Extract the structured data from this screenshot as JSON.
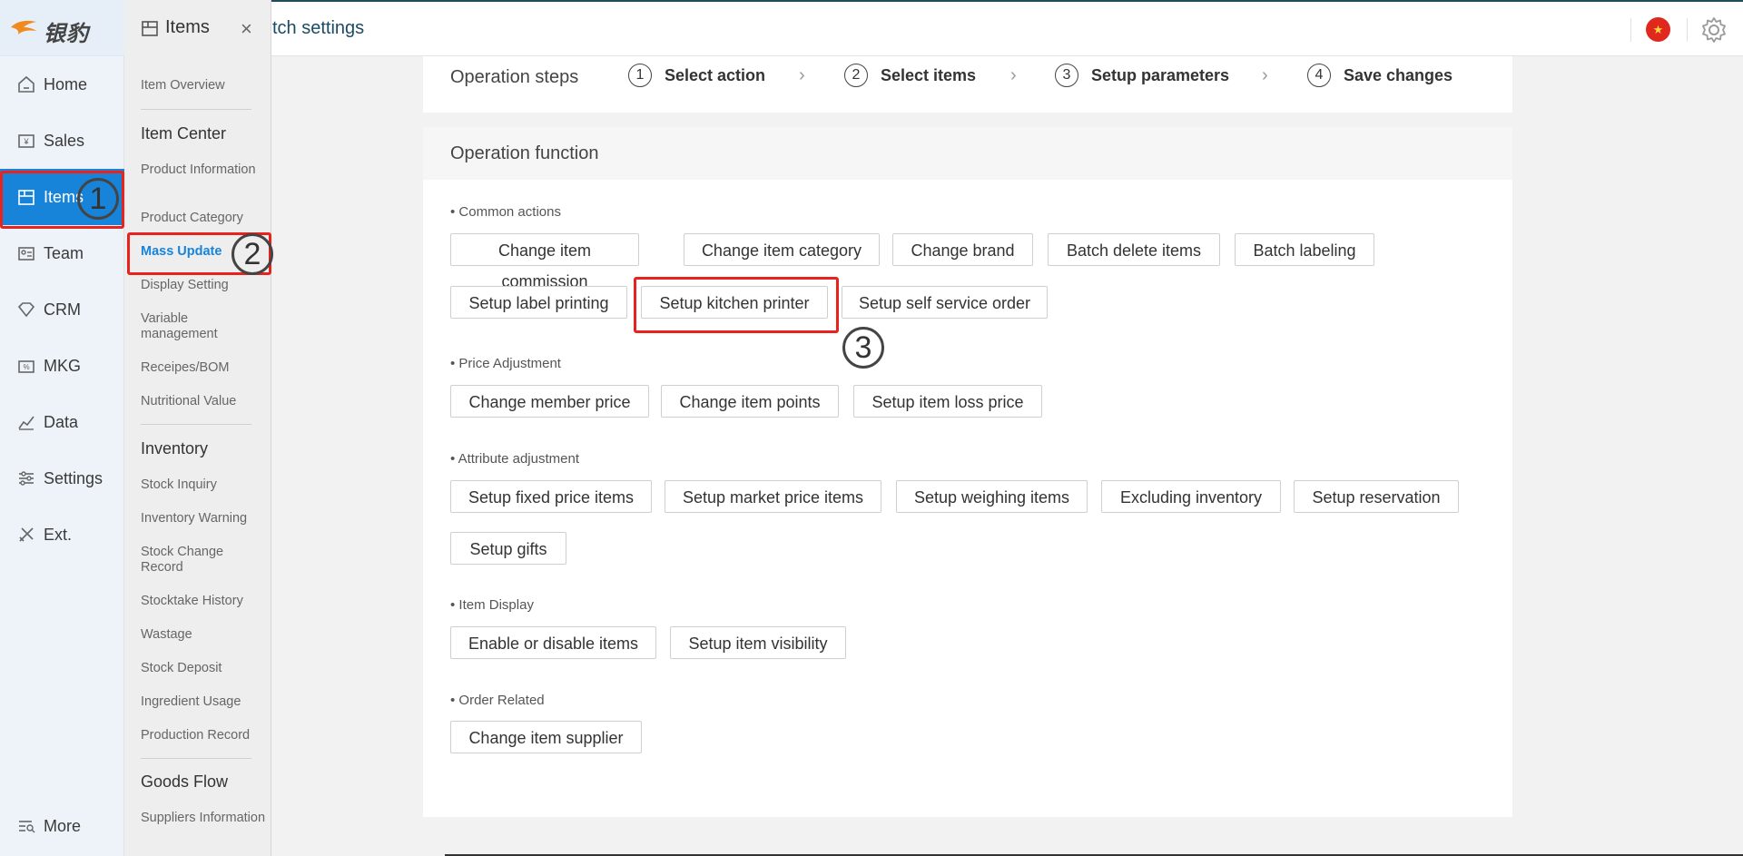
{
  "topbar": {
    "page_title": "tch settings",
    "flag_glyph": "★",
    "settings_icon": "gear-icon"
  },
  "logo": {
    "text": "银豹"
  },
  "sidebar": {
    "items": [
      {
        "label": "Home",
        "icon": "home-icon"
      },
      {
        "label": "Sales",
        "icon": "sales-icon"
      },
      {
        "label": "Items",
        "icon": "items-icon",
        "active": true
      },
      {
        "label": "Team",
        "icon": "team-icon"
      },
      {
        "label": "CRM",
        "icon": "crm-icon"
      },
      {
        "label": "MKG",
        "icon": "mkg-icon"
      },
      {
        "label": "Data",
        "icon": "data-icon"
      },
      {
        "label": "Settings",
        "icon": "settings-icon"
      },
      {
        "label": "Ext.",
        "icon": "ext-icon"
      }
    ],
    "more_label": "More"
  },
  "submenu": {
    "title": "Items",
    "close": "×",
    "overview": "Item Overview",
    "sections": [
      {
        "title": "Item Center",
        "links": [
          "Product Information",
          "Product Category",
          "Mass Update",
          "Display Setting",
          "Variable management",
          "Receipes/BOM",
          "Nutritional Value"
        ]
      },
      {
        "title": "Inventory",
        "links": [
          "Stock Inquiry",
          "Inventory Warning",
          "Stock Change Record",
          "Stocktake History",
          "Wastage",
          "Stock Deposit",
          "Ingredient Usage",
          "Production Record"
        ]
      },
      {
        "title": "Goods Flow",
        "links": [
          "Suppliers Information"
        ]
      }
    ]
  },
  "steps": {
    "label": "Operation steps",
    "items": [
      {
        "num": "1",
        "label": "Select action"
      },
      {
        "num": "2",
        "label": "Select items"
      },
      {
        "num": "3",
        "label": "Setup parameters"
      },
      {
        "num": "4",
        "label": "Save changes"
      }
    ],
    "arrow": "›"
  },
  "function": {
    "title": "Operation function",
    "groups": [
      {
        "label": "• Common actions",
        "buttons": [
          "Change item commission",
          "Change item category",
          "Change brand",
          "Batch delete items",
          "Batch labeling",
          "Setup label printing",
          "Setup kitchen printer",
          "Setup self service order"
        ]
      },
      {
        "label": "• Price Adjustment",
        "buttons": [
          "Change member price",
          "Change item points",
          "Setup item loss price"
        ]
      },
      {
        "label": "• Attribute adjustment",
        "buttons": [
          "Setup fixed price items",
          "Setup market price items",
          "Setup weighing items",
          "Excluding inventory",
          "Setup reservation",
          "Setup gifts"
        ]
      },
      {
        "label": "• Item Display",
        "buttons": [
          "Enable or disable items",
          "Setup item visibility"
        ]
      },
      {
        "label": "• Order Related",
        "buttons": [
          "Change item supplier"
        ]
      }
    ]
  },
  "annotations": {
    "badge1": "1",
    "badge2": "2",
    "badge3": "3"
  },
  "colors": {
    "accent": "#1784d9",
    "highlight": "#e8221c",
    "active_link": "#1784d9"
  }
}
